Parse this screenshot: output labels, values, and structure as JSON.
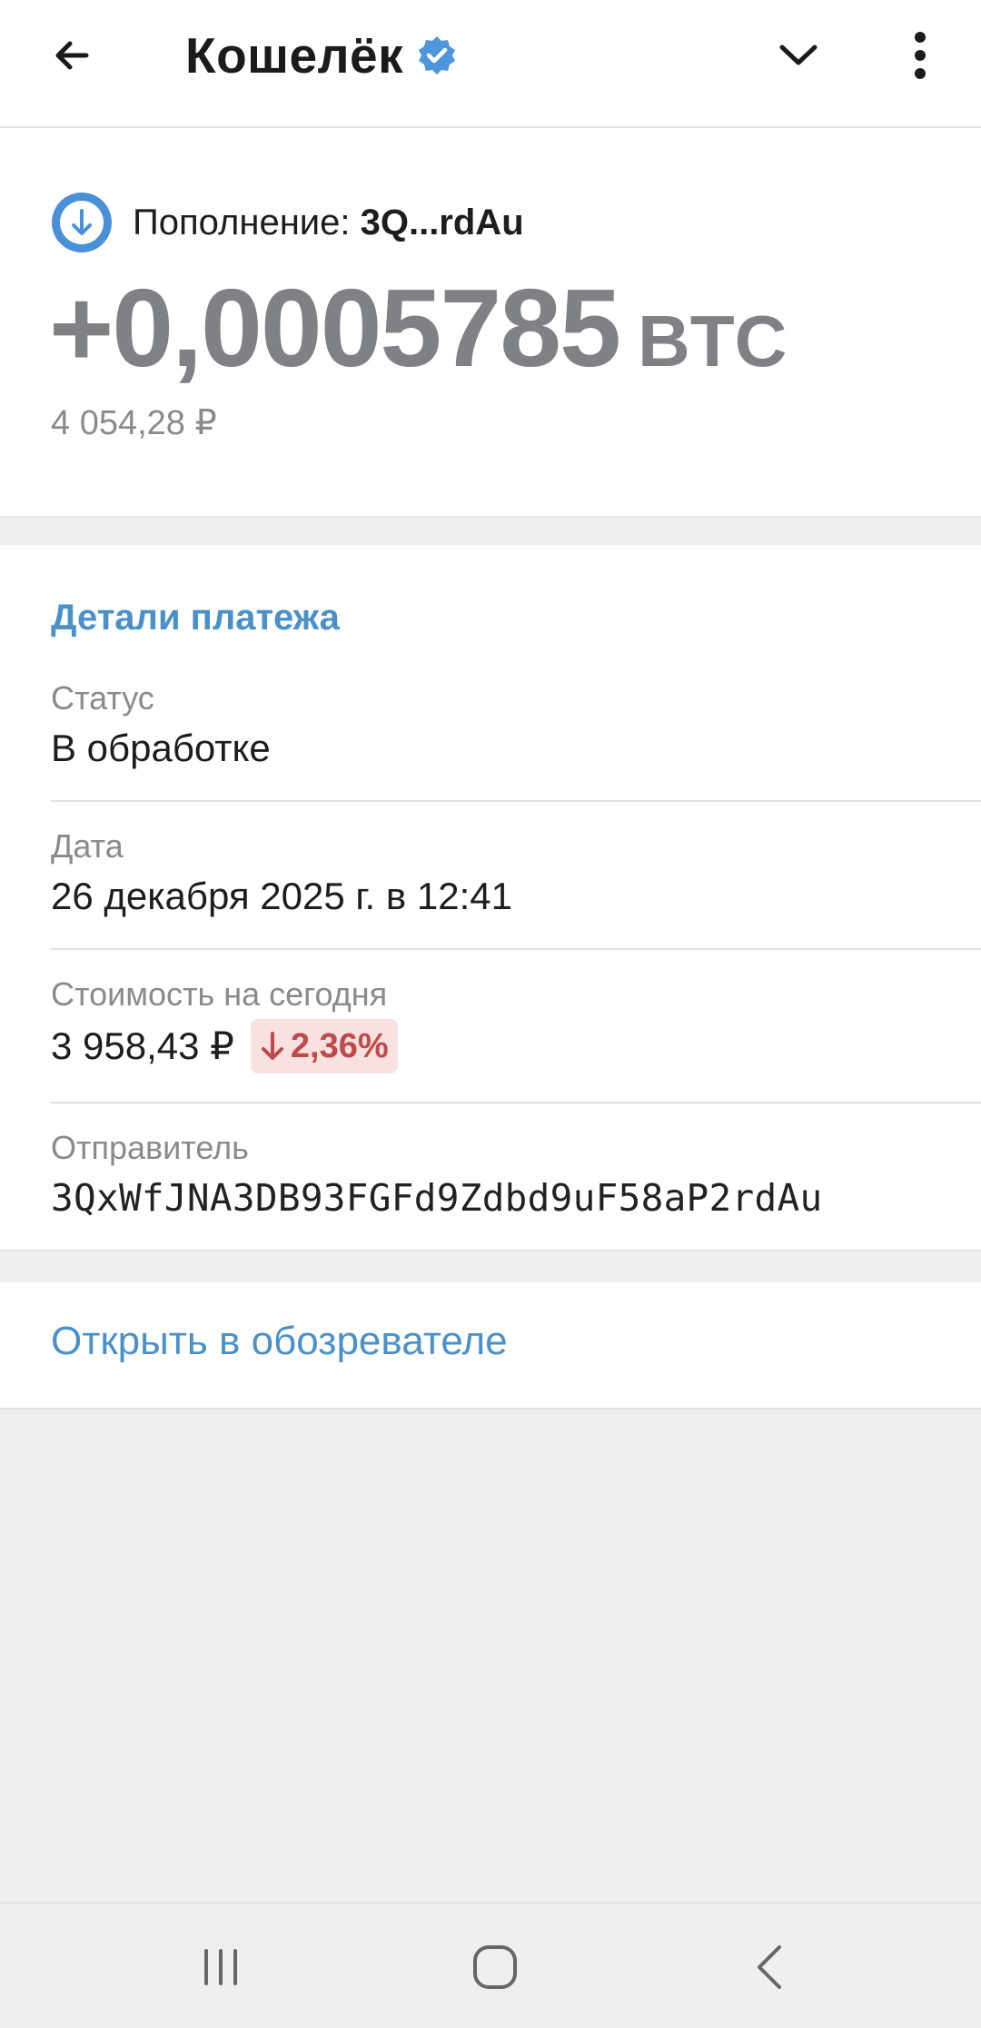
{
  "header": {
    "title": "Кошелёк",
    "icons": {
      "back": "arrow-left-icon",
      "verified": "verified-badge-icon",
      "expand": "chevron-down-icon",
      "more": "more-vert-icon"
    }
  },
  "transaction": {
    "type_label": "Пополнение: ",
    "short_address": "3Q...rdAu",
    "amount": "+0,0005785",
    "currency": "BTC",
    "fiat_amount": "4 054,28 ₽",
    "icon": "deposit-arrow-icon"
  },
  "details": {
    "section_title": "Детали платежа",
    "rows": [
      {
        "label": "Статус",
        "value": "В обработке"
      },
      {
        "label": "Дата",
        "value": "26 декабря 2025 г. в 12:41"
      },
      {
        "label": "Стоимость на сегодня",
        "value": "3 958,43 ₽",
        "change": "2,36%",
        "change_direction": "down"
      },
      {
        "label": "Отправитель",
        "value": "3QxWfJNA3DB93FGFd9Zdbd9uF58aP2rdAu"
      }
    ]
  },
  "explorer": {
    "link_label": "Открыть в обозревателе"
  },
  "colors": {
    "accent": "#4a90c9",
    "amount_gray": "#808185",
    "negative": "#c04a4a",
    "negative_bg": "#f7e1e1",
    "background": "#efefef"
  },
  "system_nav": {
    "icons": [
      "recent-apps-icon",
      "home-icon",
      "back-icon"
    ]
  }
}
